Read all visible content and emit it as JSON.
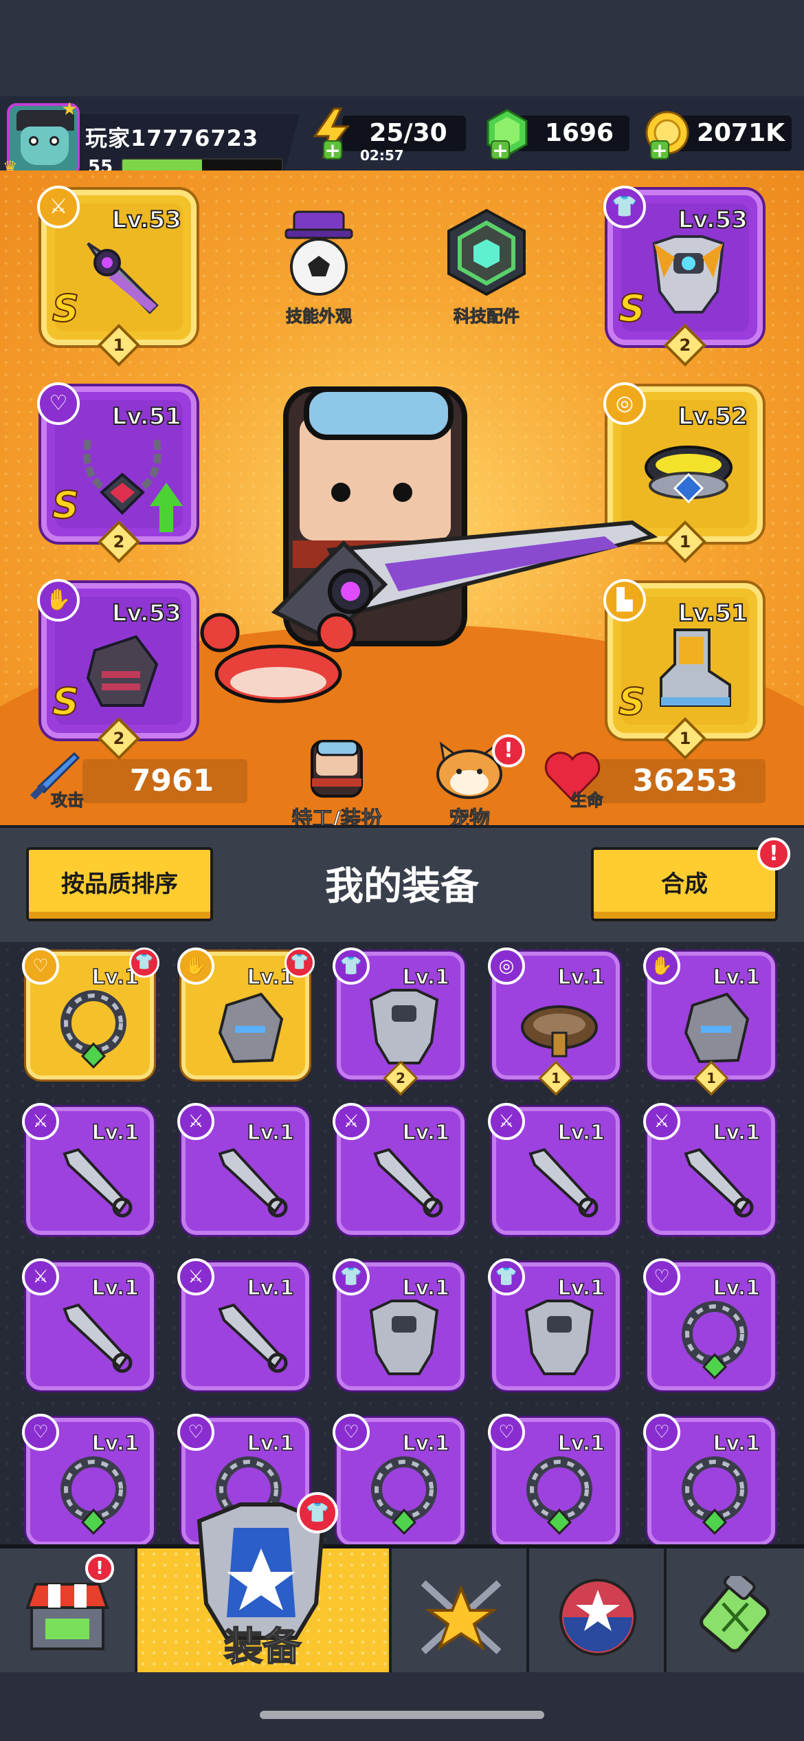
{
  "player": {
    "name": "玩家17776723",
    "level": "55",
    "xp_progress": 0.5
  },
  "resources": {
    "energy": "25/30",
    "energy_timer": "02:57",
    "gems": "1696",
    "coins": "2071K"
  },
  "equipped": {
    "weapon": {
      "level": "Lv.53",
      "grade": "S",
      "stars": "1",
      "rarity": "gold"
    },
    "armor": {
      "level": "Lv.53",
      "grade": "S",
      "stars": "2",
      "rarity": "purple"
    },
    "necklace": {
      "level": "Lv.51",
      "grade": "S",
      "stars": "2",
      "rarity": "purple"
    },
    "belt": {
      "level": "Lv.52",
      "grade": "",
      "stars": "1",
      "rarity": "gold"
    },
    "gloves": {
      "level": "Lv.53",
      "grade": "S",
      "stars": "2",
      "rarity": "purple"
    },
    "boots": {
      "level": "Lv.51",
      "grade": "S",
      "stars": "1",
      "rarity": "gold"
    }
  },
  "features": {
    "skill_skin": "技能外观",
    "tech_parts": "科技配件",
    "agent_outfit": "特工/装扮",
    "pets": "宠物"
  },
  "stats": {
    "attack_label": "攻击",
    "attack_value": "7961",
    "hp_label": "生命",
    "hp_value": "36253"
  },
  "inventory": {
    "sort_button": "按品质排序",
    "title": "我的装备",
    "merge_button": "合成",
    "notif_mark": "!",
    "items": [
      {
        "level": "Lv.1",
        "rarity": "gold",
        "type": "necklace",
        "count": "",
        "new": true
      },
      {
        "level": "Lv.1",
        "rarity": "gold",
        "type": "gloves",
        "count": "",
        "new": true
      },
      {
        "level": "Lv.1",
        "rarity": "purple",
        "type": "armor",
        "count": "2",
        "new": false
      },
      {
        "level": "Lv.1",
        "rarity": "purple",
        "type": "belt",
        "count": "1",
        "new": false
      },
      {
        "level": "Lv.1",
        "rarity": "purple",
        "type": "gloves",
        "count": "1",
        "new": false
      },
      {
        "level": "Lv.1",
        "rarity": "purple",
        "type": "weapon",
        "count": "",
        "new": false
      },
      {
        "level": "Lv.1",
        "rarity": "purple",
        "type": "weapon",
        "count": "",
        "new": false
      },
      {
        "level": "Lv.1",
        "rarity": "purple",
        "type": "weapon",
        "count": "",
        "new": false
      },
      {
        "level": "Lv.1",
        "rarity": "purple",
        "type": "weapon",
        "count": "",
        "new": false
      },
      {
        "level": "Lv.1",
        "rarity": "purple",
        "type": "weapon",
        "count": "",
        "new": false
      },
      {
        "level": "Lv.1",
        "rarity": "purple",
        "type": "weapon",
        "count": "",
        "new": false
      },
      {
        "level": "Lv.1",
        "rarity": "purple",
        "type": "weapon",
        "count": "",
        "new": false
      },
      {
        "level": "Lv.1",
        "rarity": "purple",
        "type": "armor",
        "count": "",
        "new": false
      },
      {
        "level": "Lv.1",
        "rarity": "purple",
        "type": "armor",
        "count": "",
        "new": false
      },
      {
        "level": "Lv.1",
        "rarity": "purple",
        "type": "necklace",
        "count": "",
        "new": false
      },
      {
        "level": "Lv.1",
        "rarity": "purple",
        "type": "necklace",
        "count": "",
        "new": false
      },
      {
        "level": "Lv.1",
        "rarity": "purple",
        "type": "necklace",
        "count": "",
        "new": false
      },
      {
        "level": "Lv.1",
        "rarity": "purple",
        "type": "necklace",
        "count": "",
        "new": false
      },
      {
        "level": "Lv.1",
        "rarity": "purple",
        "type": "necklace",
        "count": "",
        "new": false
      },
      {
        "level": "Lv.1",
        "rarity": "purple",
        "type": "necklace",
        "count": "",
        "new": false
      }
    ]
  },
  "nav": {
    "equipment_label": "装备",
    "tabs": [
      "shop",
      "equipment",
      "battle",
      "talents",
      "evolution"
    ]
  },
  "colors": {
    "accent": "#ffcd30",
    "purple_rarity": "#9d42de",
    "gold_rarity": "#f5c12a",
    "hero_bg": "#f59b2e",
    "notif_red": "#e8283e"
  }
}
